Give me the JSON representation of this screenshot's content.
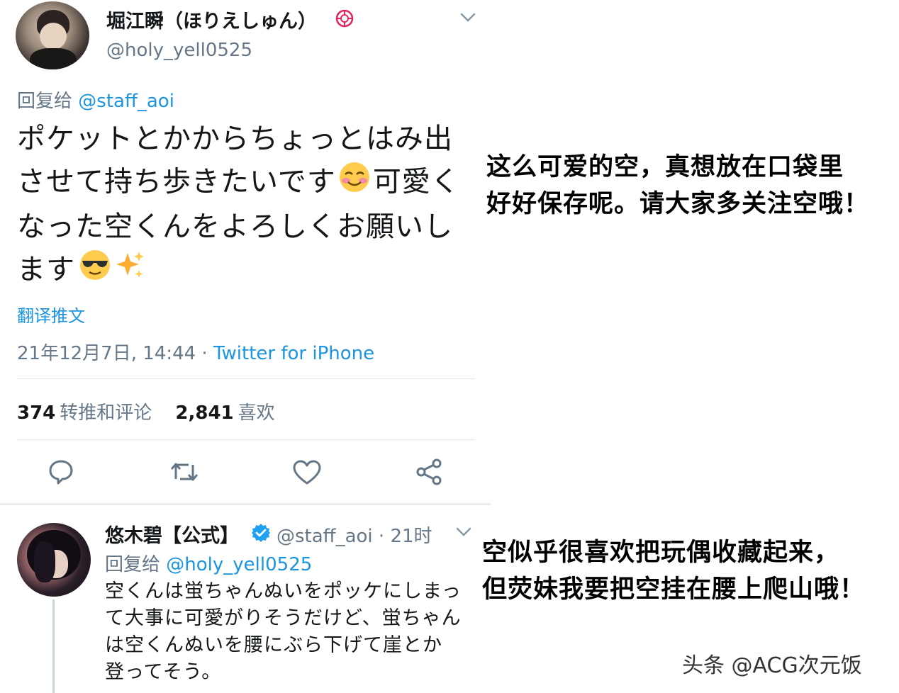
{
  "tweet": {
    "author_name": "堀江瞬（ほりえしゅん）",
    "author_handle": "@holy_yell0525",
    "reply_prefix": "回复给",
    "reply_to": "@staff_aoi",
    "text_lines": [
      "ポケットとかからちょっとはみ出",
      "させて持ち歩きたいです",
      "可愛く",
      "なった空くんをよろしくお願いし",
      "ます"
    ],
    "translate_label": "翻译推文",
    "timestamp": "21年12月7日, 14:44 · ",
    "source": "Twitter for iPhone",
    "retweets_count": "374",
    "retweets_label": "转推和评论",
    "likes_count": "2,841",
    "likes_label": "喜欢"
  },
  "reply": {
    "author_name": "悠木碧【公式】",
    "author_handle": "@staff_aoi · 21时",
    "reply_prefix": "回复给",
    "reply_to": "@holy_yell0525",
    "text_lines": [
      "空くんは蛍ちゃんぬいをポッケにしまっ",
      "て大事に可愛がりそうだけど、蛍ちゃん",
      "は空くんぬいを腰にぶら下げて崖とか",
      "登ってそう。"
    ]
  },
  "captions": {
    "top_lines": [
      "这么可爱的空，真想放在口袋里",
      "好好保存呢。请大家多关注空哦！"
    ],
    "bottom_lines": [
      "空似乎很喜欢把玩偶收藏起来，",
      "但荧妹我要把空挂在腰上爬山哦！"
    ],
    "watermark": "头条 @ACG次元饭"
  },
  "colors": {
    "link": "#1b95e0",
    "muted": "#657786",
    "verified": "#1da1f2",
    "badge": "#e0245e"
  }
}
